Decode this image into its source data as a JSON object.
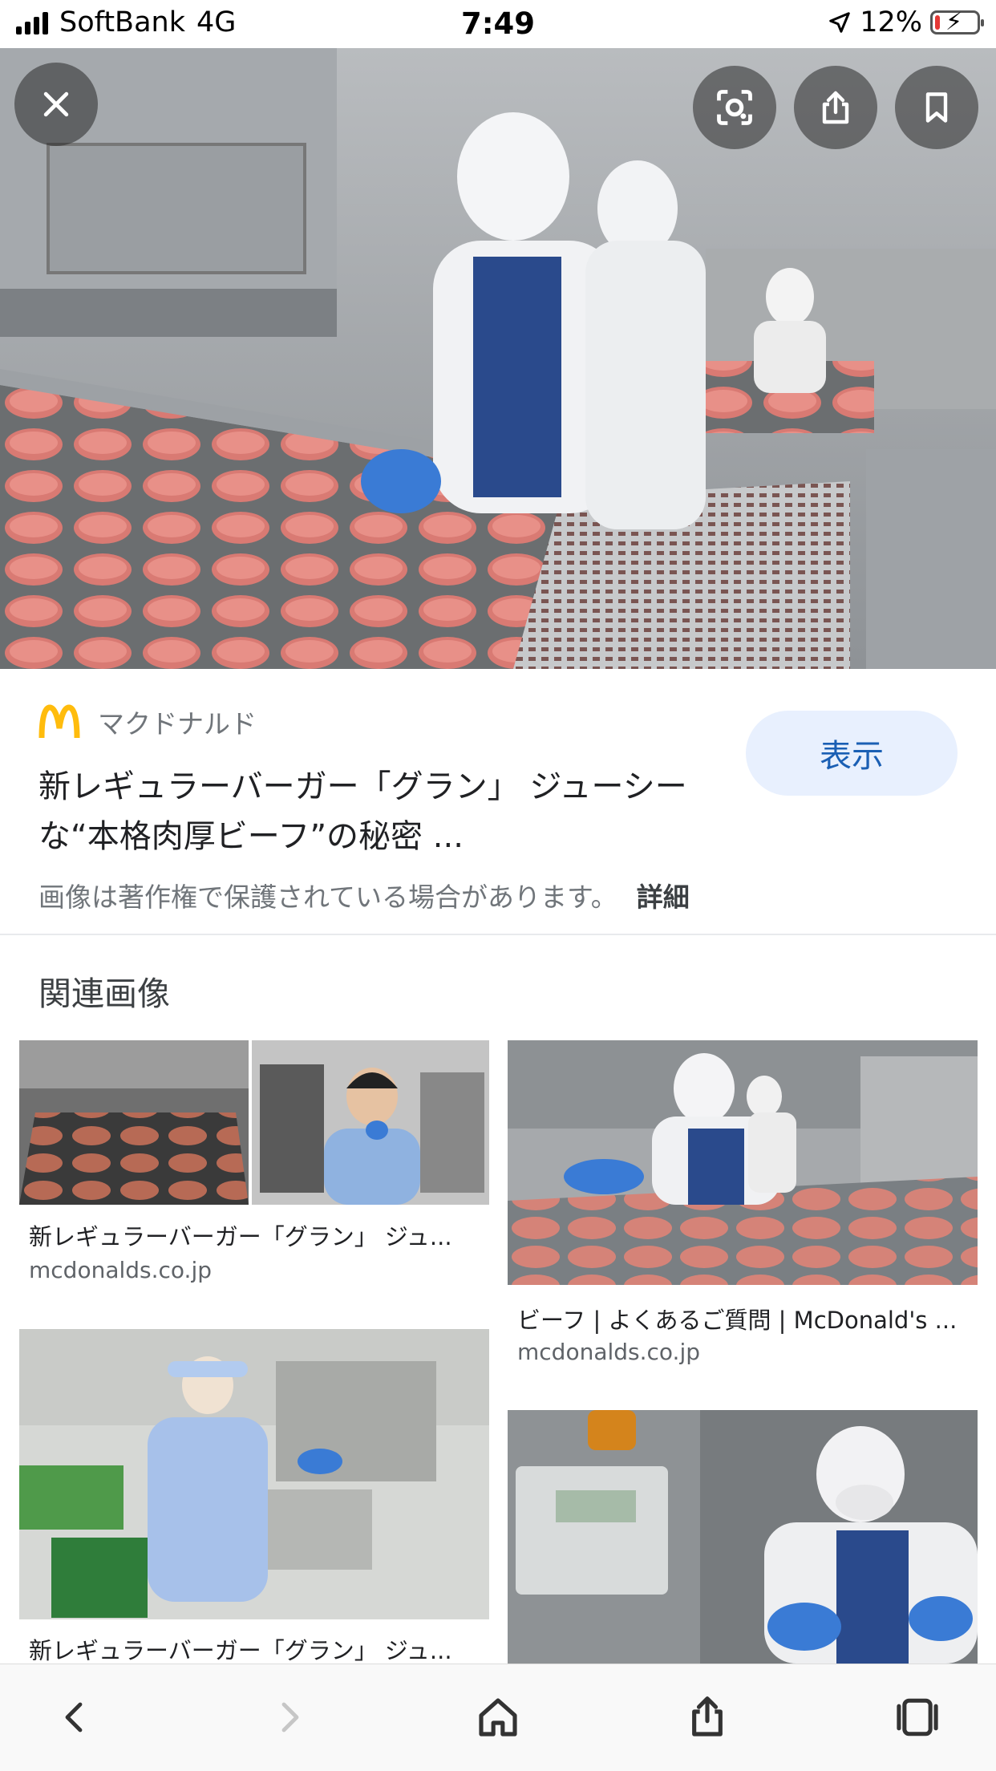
{
  "status_bar": {
    "carrier": "SoftBank",
    "network": "4G",
    "time": "7:49",
    "battery": "12%",
    "battery_level": 0.12
  },
  "hero": {
    "icons": [
      "close-icon",
      "lens-icon",
      "share-icon",
      "bookmark-icon"
    ]
  },
  "result": {
    "source_name": "マクドナルド",
    "title": "新レギュラーバーガー「グラン」 ジューシーな“本格肉厚ビーフ”の秘密 ...",
    "view_label": "表示",
    "copyright_notice": "画像は著作権で保護されている場合があります。",
    "details_label": "詳細"
  },
  "related": {
    "heading": "関連画像",
    "items": [
      {
        "caption": "新レギュラーバーガー「グラン」 ジュ...",
        "domain": "mcdonalds.co.jp"
      },
      {
        "caption": "ビーフ | よくあるご質問 | McDonald's ...",
        "domain": "mcdonalds.co.jp"
      },
      {
        "caption": "新レギュラーバーガー「グラン」 ジュ...",
        "domain": ""
      },
      {
        "caption": "",
        "domain": ""
      }
    ]
  },
  "colors": {
    "accent": "#1a5fb4",
    "button_bg": "#e8f0fe",
    "mcdonalds_yellow": "#ffbc0d",
    "battery_low": "#e53935"
  }
}
